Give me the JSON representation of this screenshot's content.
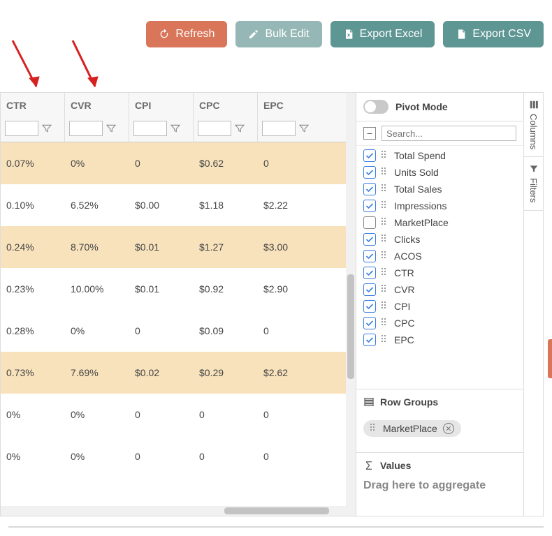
{
  "toolbar": {
    "refresh": "Refresh",
    "bulk_edit": "Bulk Edit",
    "export_excel": "Export Excel",
    "export_csv": "Export CSV"
  },
  "grid": {
    "columns": [
      "CTR",
      "CVR",
      "CPI",
      "CPC",
      "EPC"
    ],
    "rows": [
      {
        "alt": true,
        "cells": [
          "0.07%",
          "0%",
          "0",
          "$0.62",
          "0"
        ]
      },
      {
        "alt": false,
        "cells": [
          "0.10%",
          "6.52%",
          "$0.00",
          "$1.18",
          "$2.22"
        ]
      },
      {
        "alt": true,
        "cells": [
          "0.24%",
          "8.70%",
          "$0.01",
          "$1.27",
          "$3.00"
        ]
      },
      {
        "alt": false,
        "cells": [
          "0.23%",
          "10.00%",
          "$0.01",
          "$0.92",
          "$2.90"
        ]
      },
      {
        "alt": false,
        "cells": [
          "0.28%",
          "0%",
          "0",
          "$0.09",
          "0"
        ]
      },
      {
        "alt": true,
        "cells": [
          "0.73%",
          "7.69%",
          "$0.02",
          "$0.29",
          "$2.62"
        ]
      },
      {
        "alt": false,
        "cells": [
          "0%",
          "0%",
          "0",
          "0",
          "0"
        ]
      },
      {
        "alt": false,
        "cells": [
          "0%",
          "0%",
          "0",
          "0",
          "0"
        ]
      }
    ]
  },
  "sidepanel": {
    "pivot_label": "Pivot Mode",
    "search_placeholder": "Search...",
    "columns": [
      {
        "label": "Total Spend",
        "checked": true
      },
      {
        "label": "Units Sold",
        "checked": true
      },
      {
        "label": "Total Sales",
        "checked": true
      },
      {
        "label": "Impressions",
        "checked": true
      },
      {
        "label": "MarketPlace",
        "checked": false
      },
      {
        "label": "Clicks",
        "checked": true
      },
      {
        "label": "ACOS",
        "checked": true
      },
      {
        "label": "CTR",
        "checked": true
      },
      {
        "label": "CVR",
        "checked": true
      },
      {
        "label": "CPI",
        "checked": true
      },
      {
        "label": "CPC",
        "checked": true
      },
      {
        "label": "EPC",
        "checked": true
      }
    ],
    "row_groups_label": "Row Groups",
    "row_group_chip": "MarketPlace",
    "values_label": "Values",
    "values_placeholder": "Drag here to aggregate",
    "tabs": {
      "columns": "Columns",
      "filters": "Filters"
    }
  }
}
